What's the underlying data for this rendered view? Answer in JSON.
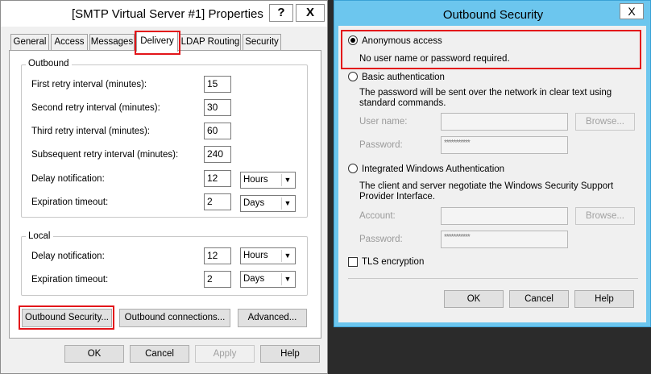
{
  "left_dialog": {
    "title": "[SMTP Virtual Server #1] Properties",
    "help_caption": "?",
    "close_caption": "X",
    "tabs": [
      {
        "label": "General"
      },
      {
        "label": "Access"
      },
      {
        "label": "Messages"
      },
      {
        "label": "Delivery"
      },
      {
        "label": "LDAP Routing"
      },
      {
        "label": "Security"
      }
    ],
    "outbound": {
      "legend": "Outbound",
      "first_retry": {
        "label": "First retry interval (minutes):",
        "value": "15"
      },
      "second_retry": {
        "label": "Second retry interval (minutes):",
        "value": "30"
      },
      "third_retry": {
        "label": "Third retry interval (minutes):",
        "value": "60"
      },
      "subsequent_retry": {
        "label": "Subsequent retry interval (minutes):",
        "value": "240"
      },
      "delay_notification": {
        "label": "Delay notification:",
        "value": "12",
        "unit": "Hours"
      },
      "expiration_timeout": {
        "label": "Expiration timeout:",
        "value": "2",
        "unit": "Days"
      }
    },
    "local": {
      "legend": "Local",
      "delay_notification": {
        "label": "Delay notification:",
        "value": "12",
        "unit": "Hours"
      },
      "expiration_timeout": {
        "label": "Expiration timeout:",
        "value": "2",
        "unit": "Days"
      }
    },
    "buttons": {
      "outbound_security": "Outbound Security...",
      "outbound_connections": "Outbound connections...",
      "advanced": "Advanced...",
      "ok": "OK",
      "cancel": "Cancel",
      "apply": "Apply",
      "help": "Help"
    }
  },
  "right_dialog": {
    "title": "Outbound Security",
    "close_caption": "X",
    "anonymous": {
      "label": "Anonymous access",
      "desc": "No user name or password required.",
      "selected": true
    },
    "basic": {
      "label": "Basic authentication",
      "desc": "The password will be sent over the network in clear text using standard commands.",
      "user_label": "User name:",
      "password_label": "Password:",
      "password_mask": "***********",
      "browse": "Browse..."
    },
    "integrated": {
      "label": "Integrated Windows Authentication",
      "desc": "The client and server negotiate the Windows Security Support Provider Interface.",
      "account_label": "Account:",
      "password_label": "Password:",
      "password_mask": "***********",
      "browse": "Browse..."
    },
    "tls": {
      "label": "TLS encryption",
      "checked": false
    },
    "buttons": {
      "ok": "OK",
      "cancel": "Cancel",
      "help": "Help"
    }
  },
  "colors": {
    "highlight": "#e3151a",
    "title_bar_active": "#6cc6ee"
  }
}
